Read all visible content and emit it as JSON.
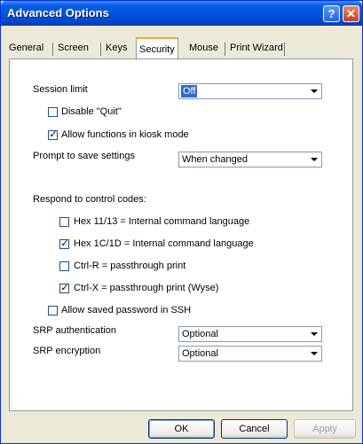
{
  "window": {
    "title": "Advanced Options"
  },
  "titlebar_buttons": {
    "help": "?",
    "close": "✕"
  },
  "tabs": [
    {
      "label": "General"
    },
    {
      "label": "Screen"
    },
    {
      "label": "Keys"
    },
    {
      "label": "Security"
    },
    {
      "label": "Mouse"
    },
    {
      "label": "Print Wizard"
    }
  ],
  "active_tab": "Security",
  "security": {
    "session_limit": {
      "label": "Session limit",
      "value": "Off"
    },
    "disable_quit": {
      "label": "Disable \"Quit\"",
      "checked": false
    },
    "kiosk_mode": {
      "label": "Allow functions in kiosk mode",
      "checked": true
    },
    "prompt_save": {
      "label": "Prompt to save settings",
      "value": "When changed"
    },
    "control_codes_heading": "Respond to control codes:",
    "control_codes": [
      {
        "label": "Hex 11/13 = Internal command language",
        "checked": false
      },
      {
        "label": "Hex 1C/1D = Internal command language",
        "checked": true
      },
      {
        "label": "Ctrl-R = passthrough print",
        "checked": false
      },
      {
        "label": "Ctrl-X = passthrough print (Wyse)",
        "checked": true
      }
    ],
    "saved_password_ssh": {
      "label": "Allow saved password in SSH",
      "checked": false
    },
    "srp_auth": {
      "label": "SRP authentication",
      "value": "Optional"
    },
    "srp_enc": {
      "label": "SRP encryption",
      "value": "Optional"
    }
  },
  "buttons": {
    "ok": "OK",
    "cancel": "Cancel",
    "apply": "Apply"
  },
  "colors": {
    "title_bar": "#0054e3",
    "selection": "#316ac5",
    "tab_highlight": "#f6a83a"
  }
}
